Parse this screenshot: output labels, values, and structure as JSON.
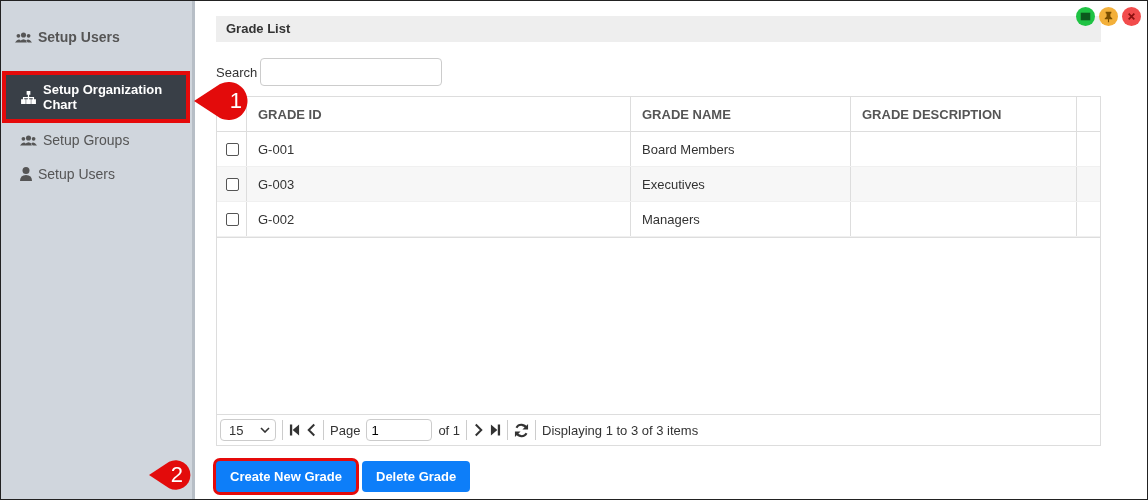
{
  "sidebar": {
    "header": {
      "label": "Setup Users"
    },
    "items": [
      {
        "label": "Setup Organization Chart",
        "kind": "sitemap",
        "selected": true,
        "highlighted": true
      },
      {
        "label": "Setup Groups",
        "kind": "group",
        "selected": false,
        "highlighted": false
      },
      {
        "label": "Setup Users",
        "kind": "person",
        "selected": false,
        "highlighted": false
      }
    ]
  },
  "panel": {
    "title": "Grade List"
  },
  "search": {
    "label": "Search"
  },
  "table": {
    "columns": [
      "GRADE ID",
      "GRADE NAME",
      "GRADE DESCRIPTION"
    ],
    "rows": [
      {
        "checked": false,
        "cells": [
          "G-001",
          "Board Members"
        ]
      },
      {
        "checked": false,
        "cells": [
          "G-003",
          "Executives"
        ]
      },
      {
        "checked": false,
        "cells": [
          "G-002",
          "Managers"
        ]
      }
    ]
  },
  "pager": {
    "page_size": "15",
    "page_label": "Page",
    "page": "1",
    "of": "of 1",
    "status": "Displaying 1 to 3 of 3 items"
  },
  "buttons": [
    {
      "label": "Create New Grade",
      "highlighted": true
    },
    {
      "label": "Delete Grade",
      "highlighted": false
    }
  ],
  "callouts": [
    {
      "label": "1"
    },
    {
      "label": "2"
    }
  ]
}
